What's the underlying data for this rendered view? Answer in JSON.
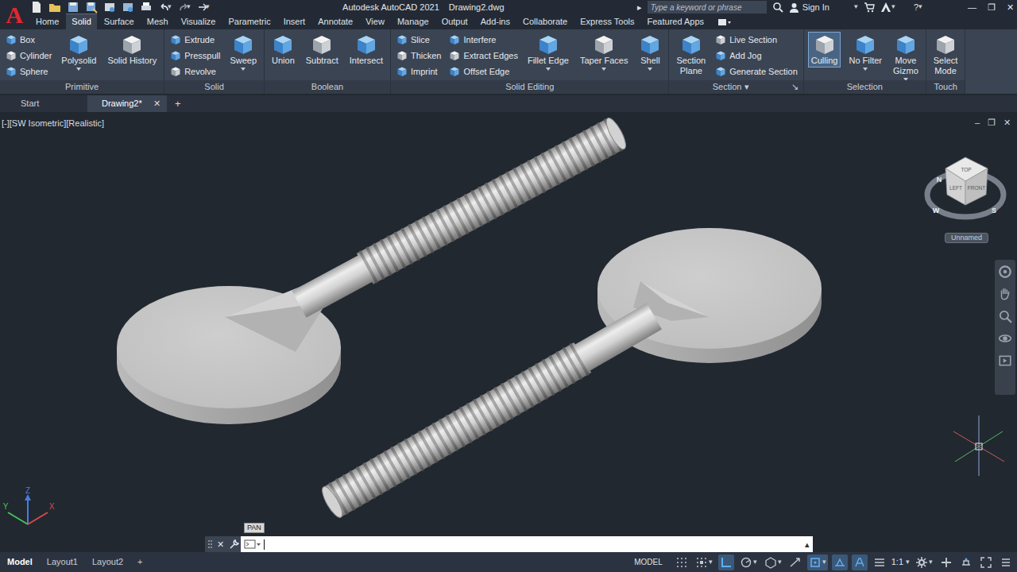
{
  "app": {
    "logo": "A",
    "title": "Autodesk AutoCAD 2021",
    "file": "Drawing2.dwg",
    "search_arrow": "▸",
    "search_placeholder": "Type a keyword or phrase",
    "sign_in": "Sign In",
    "caret": "▾",
    "help": "?",
    "window_controls": [
      "—",
      "❐",
      "✕"
    ]
  },
  "ribbon_tabs": [
    {
      "label": "Home",
      "selected": false
    },
    {
      "label": "Solid",
      "selected": true
    },
    {
      "label": "Surface",
      "selected": false
    },
    {
      "label": "Mesh",
      "selected": false
    },
    {
      "label": "Visualize",
      "selected": false
    },
    {
      "label": "Parametric",
      "selected": false
    },
    {
      "label": "Insert",
      "selected": false
    },
    {
      "label": "Annotate",
      "selected": false
    },
    {
      "label": "View",
      "selected": false
    },
    {
      "label": "Manage",
      "selected": false
    },
    {
      "label": "Output",
      "selected": false
    },
    {
      "label": "Add-ins",
      "selected": false
    },
    {
      "label": "Collaborate",
      "selected": false
    },
    {
      "label": "Express Tools",
      "selected": false
    },
    {
      "label": "Featured Apps",
      "selected": false
    }
  ],
  "panels": [
    {
      "title": "Primitive",
      "tools": [
        {
          "lines": [
            "Box"
          ],
          "kind": "small",
          "selected": false
        },
        {
          "lines": [
            "Cylinder"
          ],
          "kind": "small",
          "selected": false
        },
        {
          "lines": [
            "Sphere"
          ],
          "kind": "small",
          "selected": false
        },
        {
          "lines": [
            "Polysolid"
          ],
          "kind": "large",
          "selected": false,
          "dropdown": true
        },
        {
          "lines": [
            "Solid History"
          ],
          "kind": "large",
          "selected": false,
          "dropdown": false
        }
      ]
    },
    {
      "title": "Solid",
      "tools": [
        {
          "lines": [
            "Extrude"
          ],
          "kind": "small",
          "selected": false
        },
        {
          "lines": [
            "Presspull"
          ],
          "kind": "small",
          "selected": false
        },
        {
          "lines": [
            "Revolve"
          ],
          "kind": "small",
          "selected": false
        },
        {
          "lines": [
            "Sweep"
          ],
          "kind": "large",
          "selected": false,
          "dropdown": true
        }
      ]
    },
    {
      "title": "Boolean",
      "tools": [
        {
          "lines": [
            "Union"
          ],
          "kind": "large",
          "selected": false,
          "dropdown": false
        },
        {
          "lines": [
            "Subtract"
          ],
          "kind": "large",
          "selected": false,
          "dropdown": false
        },
        {
          "lines": [
            "Intersect"
          ],
          "kind": "large",
          "selected": false,
          "dropdown": false
        }
      ]
    },
    {
      "title": "Solid Editing",
      "tools": [
        {
          "lines": [
            "Slice"
          ],
          "kind": "small",
          "selected": false
        },
        {
          "lines": [
            "Thicken"
          ],
          "kind": "small",
          "selected": false
        },
        {
          "lines": [
            "Imprint"
          ],
          "kind": "small",
          "selected": false
        },
        {
          "lines": [
            "Interfere"
          ],
          "kind": "small",
          "selected": false
        },
        {
          "lines": [
            "Extract Edges"
          ],
          "kind": "small",
          "selected": false
        },
        {
          "lines": [
            "Offset Edge"
          ],
          "kind": "small",
          "selected": false
        },
        {
          "lines": [
            "Fillet Edge"
          ],
          "kind": "large",
          "selected": false,
          "dropdown": true
        },
        {
          "lines": [
            "Taper Faces"
          ],
          "kind": "large",
          "selected": false,
          "dropdown": true
        },
        {
          "lines": [
            "Shell"
          ],
          "kind": "large",
          "selected": false,
          "dropdown": true
        }
      ]
    },
    {
      "title": "Section",
      "menu_glyph": "▾",
      "launcher": "↘",
      "tools": [
        {
          "lines": [
            "Section",
            "Plane"
          ],
          "kind": "large",
          "selected": false,
          "dropdown": false
        },
        {
          "lines": [
            "Live Section"
          ],
          "kind": "small",
          "selected": false
        },
        {
          "lines": [
            "Add Jog"
          ],
          "kind": "small",
          "selected": false
        },
        {
          "lines": [
            "Generate Section"
          ],
          "kind": "small",
          "selected": false
        }
      ]
    },
    {
      "title": "Selection",
      "tools": [
        {
          "lines": [
            "Culling"
          ],
          "kind": "large",
          "selected": true,
          "dropdown": false
        },
        {
          "lines": [
            "No Filter"
          ],
          "kind": "large",
          "selected": false,
          "dropdown": true
        },
        {
          "lines": [
            "Move",
            "Gizmo"
          ],
          "kind": "large",
          "selected": false,
          "dropdown": true
        }
      ]
    },
    {
      "title": "Touch",
      "tools": [
        {
          "lines": [
            "Select",
            "Mode"
          ],
          "kind": "large",
          "selected": false,
          "dropdown": false
        }
      ]
    }
  ],
  "doc_tabs": [
    {
      "label": "Start",
      "selected": false
    },
    {
      "label": "Drawing2*",
      "selected": true
    }
  ],
  "doc_close": "✕",
  "doc_add": "+",
  "viewport": {
    "label": "[-][SW Isometric][Realistic]",
    "controls": [
      "–",
      "❐",
      "✕"
    ],
    "viewcube": {
      "faces": [
        "TOP",
        "LEFT",
        "FRONT"
      ],
      "compass": [
        "N",
        "W",
        "S"
      ],
      "named_view": "Unnamed"
    },
    "axes": [
      "X",
      "Y",
      "Z"
    ]
  },
  "command_line": {
    "close": "✕",
    "history_arrow": "▴",
    "tooltip": "PAN"
  },
  "layout_tabs": [
    {
      "label": "Model",
      "selected": true
    },
    {
      "label": "Layout1",
      "selected": false
    },
    {
      "label": "Layout2",
      "selected": false
    }
  ],
  "layout_add": "+",
  "status": {
    "model": "MODEL",
    "scale": "1:1",
    "caret": "▾",
    "toggles": [
      {
        "on": false,
        "menu": false
      },
      {
        "on": false,
        "menu": true
      },
      {
        "on": true,
        "menu": false
      },
      {
        "on": false,
        "menu": true
      },
      {
        "on": false,
        "menu": true
      },
      {
        "on": false,
        "menu": false
      },
      {
        "on": true,
        "menu": true
      },
      {
        "on": true,
        "menu": false
      },
      {
        "on": true,
        "menu": false
      },
      {
        "on": false,
        "menu": false
      }
    ],
    "tools": [
      {
        "on": false,
        "menu": true
      },
      {
        "on": false,
        "menu": false
      },
      {
        "on": false,
        "menu": false
      },
      {
        "on": false,
        "menu": false
      },
      {
        "on": false,
        "menu": false
      }
    ]
  }
}
